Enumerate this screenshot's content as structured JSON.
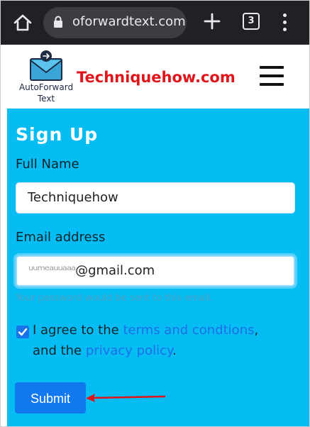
{
  "browser": {
    "url": "oforwardtext.com",
    "tab_count": "3"
  },
  "header": {
    "logo_line1": "AutoForward",
    "logo_line2": "Text",
    "watermark": "Techniquehow.com"
  },
  "form": {
    "title": "Sign Up",
    "full_name_label": "Full Name",
    "full_name_value": "Techniquehow",
    "email_label": "Email address",
    "email_masked": "ᵘᵘᵐᵉᵃᵘᵘᵃᵃᵃ",
    "email_value": "@gmail.com",
    "hint": "Your password would be sent to this email.",
    "agree_prefix": "I agree to the",
    "terms_link": "terms and condtions",
    "agree_comma": ",",
    "agree_and": "and the",
    "privacy_link": "privacy policy",
    "agree_period": ".",
    "checkbox_checked": true,
    "submit_label": "Submit"
  },
  "colors": {
    "browser_bar": "#202124",
    "form_bg": "#05bdf2",
    "link": "#1e6ee8",
    "submit_bg": "#1278f0",
    "arrow": "#e0151b"
  }
}
